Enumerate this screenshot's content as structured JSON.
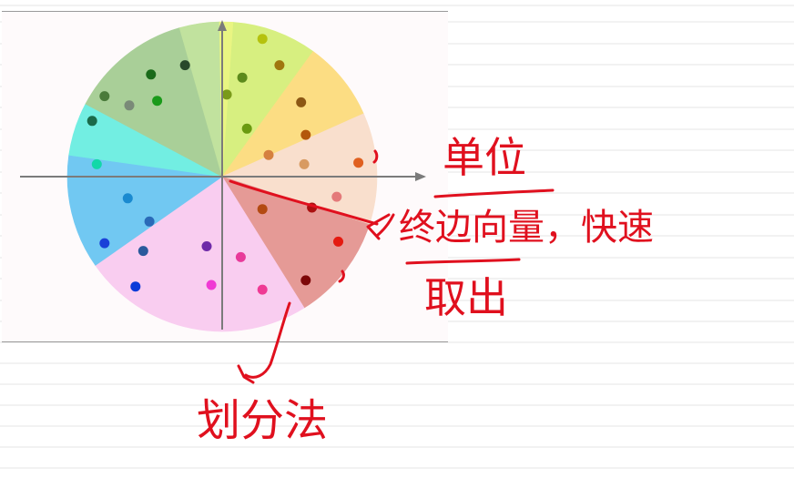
{
  "colors": {
    "ink": "#e0101e",
    "axis": "#7b7b7b",
    "note_line": "#e6e6e6"
  },
  "sectors": [
    {
      "start": -86,
      "end": -54,
      "color": "#d7ef80"
    },
    {
      "start": -54,
      "end": -24,
      "color": "#fcdd83"
    },
    {
      "start": -24,
      "end": 18,
      "color": "#f9dfcd"
    },
    {
      "start": 18,
      "end": 58,
      "color": "#e59a96"
    },
    {
      "start": 58,
      "end": 145,
      "color": "#f9cdf0"
    },
    {
      "start": 145,
      "end": 188,
      "color": "#71c8f2"
    },
    {
      "start": 188,
      "end": 208,
      "color": "#72eee2"
    },
    {
      "start": 208,
      "end": 254,
      "color": "#a9cf98"
    },
    {
      "start": 254,
      "end": 269,
      "color": "#c1e29e"
    },
    {
      "start": 269,
      "end": 274,
      "color": "#e9f582"
    }
  ],
  "points": [
    {
      "x": 0.26,
      "y": 0.89,
      "color": "#b5c20e"
    },
    {
      "x": 0.37,
      "y": 0.72,
      "color": "#a0760e"
    },
    {
      "x": 0.13,
      "y": 0.64,
      "color": "#5c8a1c"
    },
    {
      "x": 0.03,
      "y": 0.53,
      "color": "#7a9a1a"
    },
    {
      "x": 0.51,
      "y": 0.48,
      "color": "#8c5714"
    },
    {
      "x": 0.54,
      "y": 0.27,
      "color": "#b3580b"
    },
    {
      "x": 0.16,
      "y": 0.31,
      "color": "#6a9a10"
    },
    {
      "x": 0.3,
      "y": 0.14,
      "color": "#d5803f"
    },
    {
      "x": 0.53,
      "y": 0.08,
      "color": "#d89a61"
    },
    {
      "x": 0.88,
      "y": 0.09,
      "color": "#e06020"
    },
    {
      "x": 0.74,
      "y": -0.13,
      "color": "#e47a7a"
    },
    {
      "x": 0.58,
      "y": -0.2,
      "color": "#aa1010"
    },
    {
      "x": 0.26,
      "y": -0.21,
      "color": "#b34a12"
    },
    {
      "x": 0.75,
      "y": -0.42,
      "color": "#e41a10"
    },
    {
      "x": 0.54,
      "y": -0.67,
      "color": "#7d0808"
    },
    {
      "x": 0.26,
      "y": -0.73,
      "color": "#ef3a94"
    },
    {
      "x": 0.12,
      "y": -0.52,
      "color": "#e83a9a"
    },
    {
      "x": -0.1,
      "y": -0.45,
      "color": "#6e2aa8"
    },
    {
      "x": -0.07,
      "y": -0.7,
      "color": "#f03ad4"
    },
    {
      "x": -0.61,
      "y": -0.14,
      "color": "#1a8ad0"
    },
    {
      "x": -0.47,
      "y": -0.29,
      "color": "#2a6ab8"
    },
    {
      "x": -0.76,
      "y": -0.43,
      "color": "#1a40d8"
    },
    {
      "x": -0.51,
      "y": -0.48,
      "color": "#2a5a9c"
    },
    {
      "x": -0.56,
      "y": -0.71,
      "color": "#0a3ad8"
    },
    {
      "x": -0.81,
      "y": 0.08,
      "color": "#12d8a8"
    },
    {
      "x": -0.84,
      "y": 0.36,
      "color": "#1a6a4a"
    },
    {
      "x": -0.76,
      "y": 0.52,
      "color": "#4a7a3a"
    },
    {
      "x": -0.6,
      "y": 0.46,
      "color": "#7a8a78"
    },
    {
      "x": -0.42,
      "y": 0.49,
      "color": "#1a9a1a"
    },
    {
      "x": -0.46,
      "y": 0.66,
      "color": "#1a6a1a"
    },
    {
      "x": -0.24,
      "y": 0.72,
      "color": "#28482a"
    }
  ],
  "annotations": {
    "note1_line1": "单位",
    "note1_line2": "终边向量，快速",
    "note1_line3": "取出",
    "note2": "划分法"
  }
}
